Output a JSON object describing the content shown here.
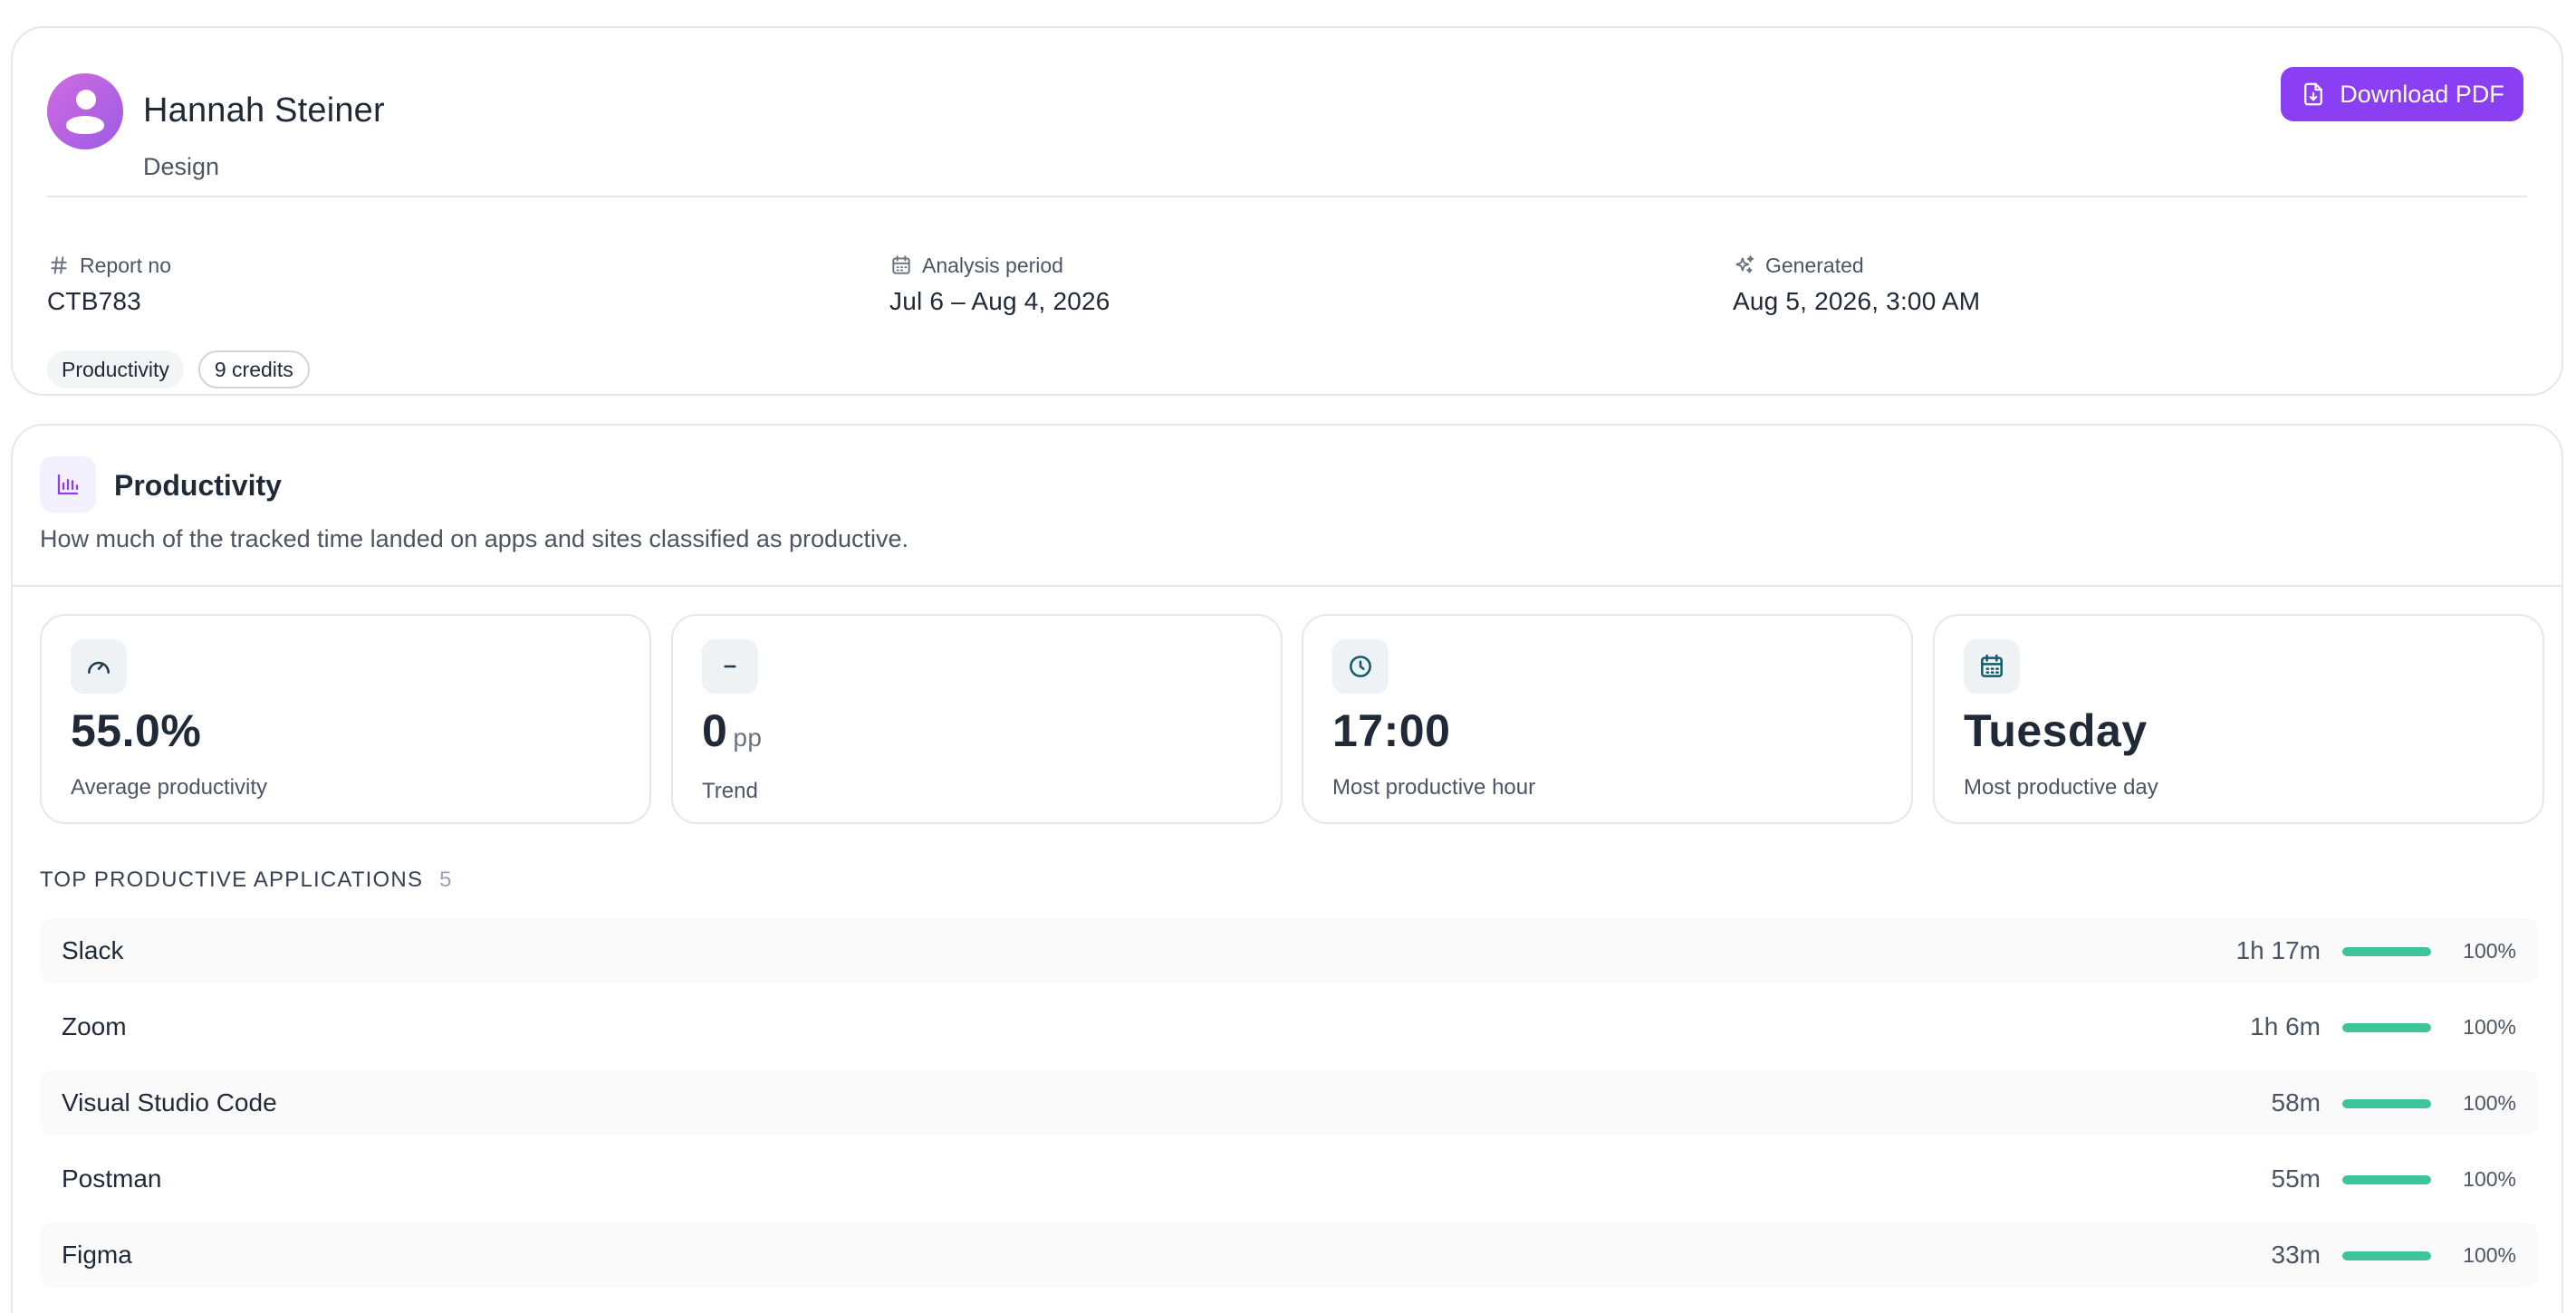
{
  "profile": {
    "name": "Hannah Steiner",
    "department": "Design"
  },
  "actions": {
    "download_label": "Download PDF"
  },
  "meta": {
    "report_no_label": "Report no",
    "report_no": "CTB783",
    "period_label": "Analysis period",
    "period": "Jul 6 – Aug 4, 2026",
    "generated_label": "Generated",
    "generated": "Aug 5, 2026, 3:00 AM"
  },
  "chips": {
    "type": "Productivity",
    "credits": "9 credits"
  },
  "section": {
    "title": "Productivity",
    "description": "How much of the tracked time landed on apps and sites classified as productive."
  },
  "stats": {
    "average": {
      "value": "55.0%",
      "label": "Average productivity",
      "icon": "gauge-icon"
    },
    "trend": {
      "value": "0",
      "unit": "pp",
      "label": "Trend",
      "icon": "minus-icon"
    },
    "hour": {
      "value": "17:00",
      "label": "Most productive hour",
      "icon": "clock-icon"
    },
    "day": {
      "value": "Tuesday",
      "label": "Most productive day",
      "icon": "calendar-icon"
    }
  },
  "apps": {
    "heading": "TOP PRODUCTIVE APPLICATIONS",
    "count": "5",
    "bar_color": "#3dc49a",
    "items": [
      {
        "name": "Slack",
        "time": "1h 17m",
        "percent": "100%",
        "fill": 1.0
      },
      {
        "name": "Zoom",
        "time": "1h 6m",
        "percent": "100%",
        "fill": 1.0
      },
      {
        "name": "Visual Studio Code",
        "time": "58m",
        "percent": "100%",
        "fill": 1.0
      },
      {
        "name": "Postman",
        "time": "55m",
        "percent": "100%",
        "fill": 1.0
      },
      {
        "name": "Figma",
        "time": "33m",
        "percent": "100%",
        "fill": 1.0
      }
    ]
  },
  "colors": {
    "accent": "#8b3ff2",
    "success": "#3dc49a"
  }
}
